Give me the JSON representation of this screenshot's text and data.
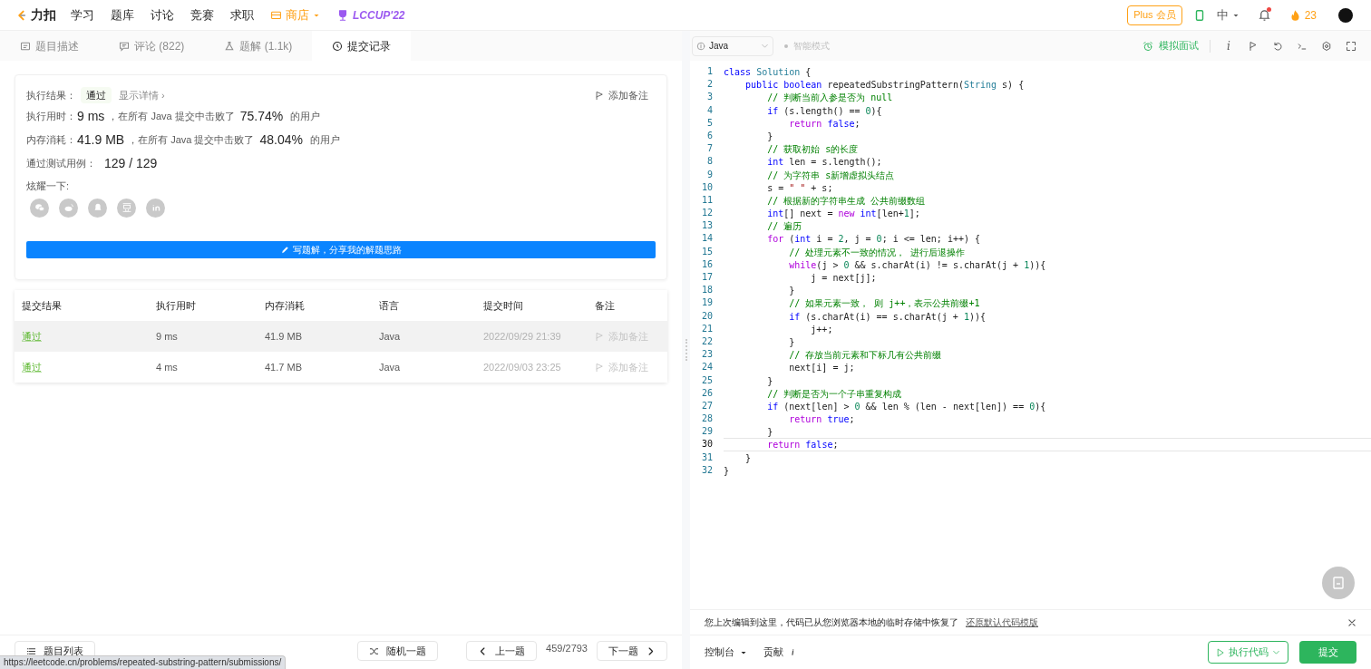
{
  "nav": {
    "logo": "力扣",
    "items": [
      {
        "label": "学习",
        "kind": "link"
      },
      {
        "label": "题库",
        "kind": "link"
      },
      {
        "label": "讨论",
        "kind": "link"
      },
      {
        "label": "竞赛",
        "kind": "link"
      },
      {
        "label": "求职",
        "kind": "link"
      },
      {
        "label": "商店",
        "kind": "store"
      },
      {
        "label": "LCCUP'22",
        "kind": "event"
      }
    ],
    "plus": "Plus 会员",
    "lang": "中",
    "notify_dot": true,
    "streak": "23"
  },
  "tabs": [
    {
      "label": "题目描述",
      "selected": false
    },
    {
      "label": "评论 (822)",
      "selected": false
    },
    {
      "label": "题解 (1.1k)",
      "selected": false
    },
    {
      "label": "提交记录",
      "selected": true
    }
  ],
  "result": {
    "label": "执行结果：",
    "status": "通过",
    "details": "显示详情 ›",
    "note": "添加备注",
    "stats": [
      {
        "label": "执行用时：",
        "value": "9 ms",
        "mid": "，在所有 Java 提交中击败了",
        "pct": "75.74%",
        "tail": "的用户"
      },
      {
        "label": "内存消耗：",
        "value": "41.9 MB",
        "mid": "，在所有 Java 提交中击败了",
        "pct": "48.04%",
        "tail": "的用户"
      }
    ],
    "cases_label": "通过测试用例：",
    "cases": "129 / 129",
    "share_label": "炫耀一下:",
    "write": "写题解，分享我的解题思路"
  },
  "table": {
    "columns": [
      "提交结果",
      "执行用时",
      "内存消耗",
      "语言",
      "提交时间",
      "备注"
    ],
    "rows": [
      {
        "status": "通过",
        "time": "9 ms",
        "memory": "41.9 MB",
        "lang": "Java",
        "submitted": "2022/09/29 21:39",
        "note": "添加备注",
        "selected": true
      },
      {
        "status": "通过",
        "time": "4 ms",
        "memory": "41.7 MB",
        "lang": "Java",
        "submitted": "2022/09/03 23:25",
        "note": "添加备注",
        "selected": false
      }
    ]
  },
  "editor": {
    "language": "Java",
    "mode": "智能模式",
    "mock": "模拟面试",
    "toolbar_text": "i",
    "lines": [
      {
        "number": "1",
        "active": false,
        "tokens": [
          {
            "kind": "keyword",
            "text": "class"
          },
          {
            "kind": "type",
            "text": " Solution"
          },
          {
            "kind": "plain",
            "text": " {"
          }
        ]
      },
      {
        "number": "2",
        "active": false,
        "tokens": [
          {
            "kind": "keyword",
            "text": "    public"
          },
          {
            "kind": "keyword",
            "text": " boolean"
          },
          {
            "kind": "plain",
            "text": " repeatedSubstringPattern("
          },
          {
            "kind": "type",
            "text": "String"
          },
          {
            "kind": "plain",
            "text": " s) {"
          }
        ]
      },
      {
        "number": "3",
        "active": false,
        "tokens": [
          {
            "kind": "comment",
            "text": "        // 判断当前入参是否为 null"
          }
        ]
      },
      {
        "number": "4",
        "active": false,
        "tokens": [
          {
            "kind": "keyword",
            "text": "        if"
          },
          {
            "kind": "plain",
            "text": " (s.length() == "
          },
          {
            "kind": "number",
            "text": "0"
          },
          {
            "kind": "plain",
            "text": "){"
          }
        ]
      },
      {
        "number": "5",
        "active": false,
        "tokens": [
          {
            "kind": "control",
            "text": "            return"
          },
          {
            "kind": "keyword",
            "text": " false"
          },
          {
            "kind": "plain",
            "text": ";"
          }
        ]
      },
      {
        "number": "6",
        "active": false,
        "tokens": [
          {
            "kind": "plain",
            "text": "        }"
          }
        ]
      },
      {
        "number": "7",
        "active": false,
        "tokens": [
          {
            "kind": "comment",
            "text": "        // 获取初始 s的长度"
          }
        ]
      },
      {
        "number": "8",
        "active": false,
        "tokens": [
          {
            "kind": "keyword",
            "text": "        int"
          },
          {
            "kind": "plain",
            "text": " len = s.length();"
          }
        ]
      },
      {
        "number": "9",
        "active": false,
        "tokens": [
          {
            "kind": "comment",
            "text": "        // 为字符串 s新增虚拟头结点"
          }
        ]
      },
      {
        "number": "10",
        "active": false,
        "tokens": [
          {
            "kind": "plain",
            "text": "        s = "
          },
          {
            "kind": "string",
            "text": "\" \""
          },
          {
            "kind": "plain",
            "text": " + s;"
          }
        ]
      },
      {
        "number": "11",
        "active": false,
        "tokens": [
          {
            "kind": "comment",
            "text": "        // 根据新的字符串生成 公共前缀数组"
          }
        ]
      },
      {
        "number": "12",
        "active": false,
        "tokens": [
          {
            "kind": "keyword",
            "text": "        int"
          },
          {
            "kind": "plain",
            "text": "[] next = "
          },
          {
            "kind": "control",
            "text": "new"
          },
          {
            "kind": "keyword",
            "text": " int"
          },
          {
            "kind": "plain",
            "text": "[len+"
          },
          {
            "kind": "number",
            "text": "1"
          },
          {
            "kind": "plain",
            "text": "];"
          }
        ]
      },
      {
        "number": "13",
        "active": false,
        "tokens": [
          {
            "kind": "comment",
            "text": "        // 遍历"
          }
        ]
      },
      {
        "number": "14",
        "active": false,
        "tokens": [
          {
            "kind": "control",
            "text": "        for"
          },
          {
            "kind": "plain",
            "text": " ("
          },
          {
            "kind": "keyword",
            "text": "int"
          },
          {
            "kind": "plain",
            "text": " i = "
          },
          {
            "kind": "number",
            "text": "2"
          },
          {
            "kind": "plain",
            "text": ", j = "
          },
          {
            "kind": "number",
            "text": "0"
          },
          {
            "kind": "plain",
            "text": "; i <= len; i++) {"
          }
        ]
      },
      {
        "number": "15",
        "active": false,
        "tokens": [
          {
            "kind": "comment",
            "text": "            // 处理元素不一致的情况， 进行后退操作"
          }
        ]
      },
      {
        "number": "16",
        "active": false,
        "tokens": [
          {
            "kind": "control",
            "text": "            while"
          },
          {
            "kind": "plain",
            "text": "(j > "
          },
          {
            "kind": "number",
            "text": "0"
          },
          {
            "kind": "plain",
            "text": " && s.charAt(i) != s.charAt(j + "
          },
          {
            "kind": "number",
            "text": "1"
          },
          {
            "kind": "plain",
            "text": ")){"
          }
        ]
      },
      {
        "number": "17",
        "active": false,
        "tokens": [
          {
            "kind": "plain",
            "text": "                j = next[j];"
          }
        ]
      },
      {
        "number": "18",
        "active": false,
        "tokens": [
          {
            "kind": "plain",
            "text": "            }"
          }
        ]
      },
      {
        "number": "19",
        "active": false,
        "tokens": [
          {
            "kind": "comment",
            "text": "            // 如果元素一致， 则 j++，表示公共前缀+1"
          }
        ]
      },
      {
        "number": "20",
        "active": false,
        "tokens": [
          {
            "kind": "keyword",
            "text": "            if"
          },
          {
            "kind": "plain",
            "text": " (s.charAt(i) == s.charAt(j + "
          },
          {
            "kind": "number",
            "text": "1"
          },
          {
            "kind": "plain",
            "text": ")){"
          }
        ]
      },
      {
        "number": "21",
        "active": false,
        "tokens": [
          {
            "kind": "plain",
            "text": "                j++;"
          }
        ]
      },
      {
        "number": "22",
        "active": false,
        "tokens": [
          {
            "kind": "plain",
            "text": "            }"
          }
        ]
      },
      {
        "number": "23",
        "active": false,
        "tokens": [
          {
            "kind": "comment",
            "text": "            // 存放当前元素和下标几有公共前缀"
          }
        ]
      },
      {
        "number": "24",
        "active": false,
        "tokens": [
          {
            "kind": "plain",
            "text": "            next[i] = j;"
          }
        ]
      },
      {
        "number": "25",
        "active": false,
        "tokens": [
          {
            "kind": "plain",
            "text": "        }"
          }
        ]
      },
      {
        "number": "26",
        "active": false,
        "tokens": [
          {
            "kind": "comment",
            "text": "        // 判断是否为一个子串重复构成"
          }
        ]
      },
      {
        "number": "27",
        "active": false,
        "tokens": [
          {
            "kind": "keyword",
            "text": "        if"
          },
          {
            "kind": "plain",
            "text": " (next[len] > "
          },
          {
            "kind": "number",
            "text": "0"
          },
          {
            "kind": "plain",
            "text": " && len % (len - next[len]) == "
          },
          {
            "kind": "number",
            "text": "0"
          },
          {
            "kind": "plain",
            "text": "){"
          }
        ]
      },
      {
        "number": "28",
        "active": false,
        "tokens": [
          {
            "kind": "control",
            "text": "            return"
          },
          {
            "kind": "keyword",
            "text": " true"
          },
          {
            "kind": "plain",
            "text": ";"
          }
        ]
      },
      {
        "number": "29",
        "active": false,
        "tokens": [
          {
            "kind": "plain",
            "text": "        }"
          }
        ]
      },
      {
        "number": "30",
        "active": true,
        "tokens": [
          {
            "kind": "control",
            "text": "        return"
          },
          {
            "kind": "keyword",
            "text": " false"
          },
          {
            "kind": "plain",
            "text": ";"
          }
        ]
      },
      {
        "number": "31",
        "active": false,
        "tokens": [
          {
            "kind": "plain",
            "text": "    }"
          }
        ]
      },
      {
        "number": "32",
        "active": false,
        "tokens": [
          {
            "kind": "plain",
            "text": "}"
          }
        ]
      }
    ]
  },
  "restore": {
    "message": "您上次编辑到这里，代码已从您浏览器本地的临时存储中恢复了",
    "link": "还原默认代码模版"
  },
  "bottom_left": {
    "list": "题目列表",
    "random": "随机一题",
    "prev": "上一题",
    "count": "459/2793",
    "next": "下一题"
  },
  "bottom_right": {
    "console": "控制台",
    "contribute": "贡献",
    "run": "执行代码",
    "submit": "提交"
  },
  "status_url": "https://leetcode.cn/problems/repeated-substring-pattern/submissions/"
}
